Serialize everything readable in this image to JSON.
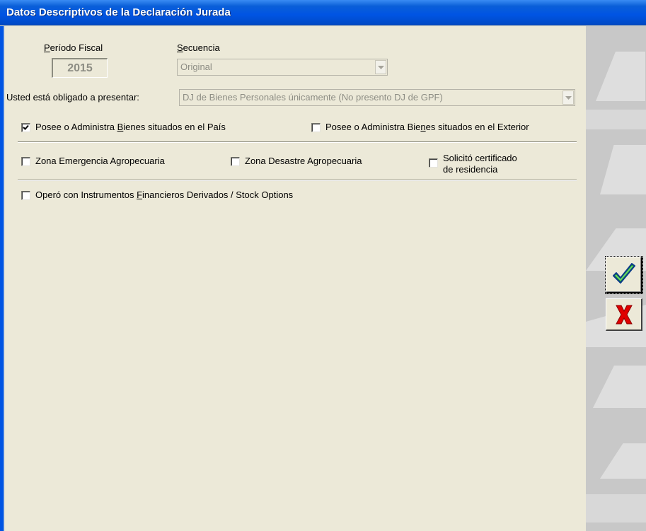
{
  "window": {
    "title": "Datos Descriptivos de la Declaración Jurada"
  },
  "form": {
    "periodo_fiscal": {
      "label_underline": "P",
      "label_rest": "eríodo Fiscal",
      "value": "2015"
    },
    "secuencia": {
      "label_underline": "S",
      "label_rest": "ecuencia",
      "value": "Original"
    },
    "obligado": {
      "label": "Usted está obligado a presentar:",
      "value": "DJ de Bienes Personales únicamente (No presento DJ de GPF)"
    },
    "checks": {
      "bienes_pais": {
        "pre": "Posee o Administra ",
        "underline": "B",
        "post": "ienes situados en el País",
        "checked": true
      },
      "bienes_exterior": {
        "pre": "Posee o Administra Bie",
        "underline": "n",
        "post": "es situados en el Exterior",
        "checked": false
      },
      "zona_emergencia": {
        "text": "Zona Emergencia Agropecuaria",
        "checked": false
      },
      "zona_desastre": {
        "text": "Zona Desastre Agropecuaria",
        "checked": false
      },
      "certificado_residencia": {
        "line1": "Solicitó certificado",
        "line2": "de residencia",
        "checked": false
      },
      "instrumentos": {
        "pre": "Operó con Instrumentos ",
        "underline": "F",
        "post": "inancieros Derivados / Stock Options",
        "checked": false
      }
    }
  },
  "colors": {
    "title_bar": "#0054e3",
    "ok_check": "#1a9a2a",
    "cancel_x": "#e00000"
  },
  "icons": {
    "ok": "checkmark-icon",
    "cancel": "x-icon"
  }
}
